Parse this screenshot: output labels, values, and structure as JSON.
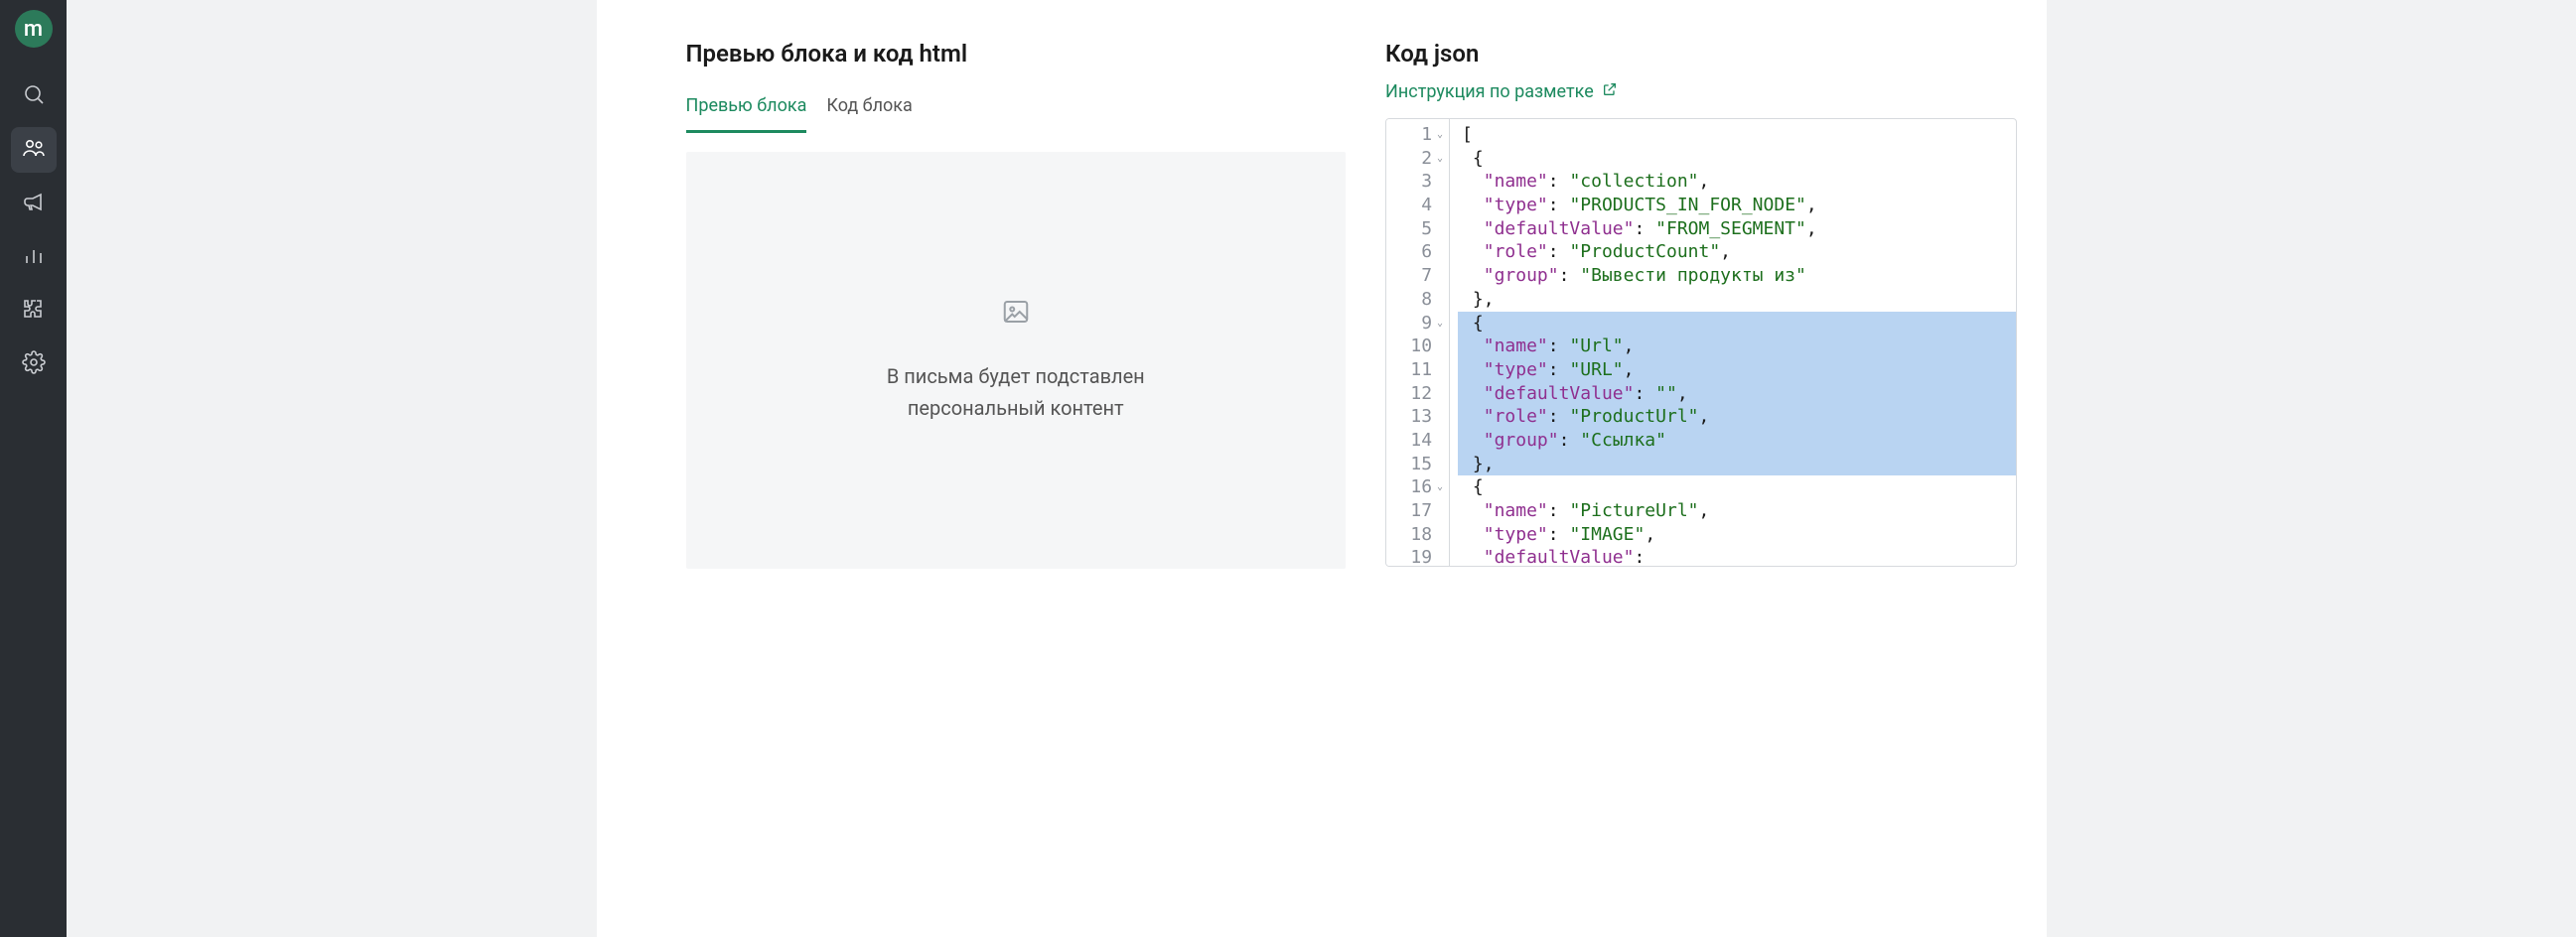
{
  "logo_letter": "m",
  "sidebar": {
    "items": [
      {
        "name": "search-icon"
      },
      {
        "name": "people-icon"
      },
      {
        "name": "megaphone-icon"
      },
      {
        "name": "bar-chart-icon"
      },
      {
        "name": "puzzle-icon"
      },
      {
        "name": "gear-icon"
      }
    ]
  },
  "page": {
    "title": "Превью блока и код html"
  },
  "tabs": [
    {
      "label": "Превью блока",
      "active": true
    },
    {
      "label": "Код блока",
      "active": false
    }
  ],
  "preview": {
    "line1": "В письма будет подставлен",
    "line2": "персональный контент"
  },
  "json_section": {
    "title": "Код json",
    "link_text": "Инструкция по разметке"
  },
  "code": {
    "lines": [
      {
        "n": 1,
        "foldable": true,
        "hl": false,
        "tokens": [
          {
            "t": "punct",
            "v": "["
          }
        ]
      },
      {
        "n": 2,
        "foldable": true,
        "hl": false,
        "tokens": [
          {
            "t": "pad",
            "v": " "
          },
          {
            "t": "punct",
            "v": "{"
          }
        ]
      },
      {
        "n": 3,
        "foldable": false,
        "hl": false,
        "tokens": [
          {
            "t": "pad",
            "v": "  "
          },
          {
            "t": "key",
            "v": "\"name\""
          },
          {
            "t": "colon",
            "v": ": "
          },
          {
            "t": "str",
            "v": "\"collection\""
          },
          {
            "t": "punct",
            "v": ","
          }
        ]
      },
      {
        "n": 4,
        "foldable": false,
        "hl": false,
        "tokens": [
          {
            "t": "pad",
            "v": "  "
          },
          {
            "t": "key",
            "v": "\"type\""
          },
          {
            "t": "colon",
            "v": ": "
          },
          {
            "t": "str",
            "v": "\"PRODUCTS_IN_FOR_NODE\""
          },
          {
            "t": "punct",
            "v": ","
          }
        ]
      },
      {
        "n": 5,
        "foldable": false,
        "hl": false,
        "tokens": [
          {
            "t": "pad",
            "v": "  "
          },
          {
            "t": "key",
            "v": "\"defaultValue\""
          },
          {
            "t": "colon",
            "v": ": "
          },
          {
            "t": "str",
            "v": "\"FROM_SEGMENT\""
          },
          {
            "t": "punct",
            "v": ","
          }
        ]
      },
      {
        "n": 6,
        "foldable": false,
        "hl": false,
        "tokens": [
          {
            "t": "pad",
            "v": "  "
          },
          {
            "t": "key",
            "v": "\"role\""
          },
          {
            "t": "colon",
            "v": ": "
          },
          {
            "t": "str",
            "v": "\"ProductCount\""
          },
          {
            "t": "punct",
            "v": ","
          }
        ]
      },
      {
        "n": 7,
        "foldable": false,
        "hl": false,
        "tokens": [
          {
            "t": "pad",
            "v": "  "
          },
          {
            "t": "key",
            "v": "\"group\""
          },
          {
            "t": "colon",
            "v": ": "
          },
          {
            "t": "str",
            "v": "\"Вывести продукты из\""
          }
        ]
      },
      {
        "n": 8,
        "foldable": false,
        "hl": false,
        "tokens": [
          {
            "t": "pad",
            "v": " "
          },
          {
            "t": "punct",
            "v": "},"
          }
        ]
      },
      {
        "n": 9,
        "foldable": true,
        "hl": true,
        "tokens": [
          {
            "t": "pad",
            "v": " "
          },
          {
            "t": "punct",
            "v": "{"
          }
        ]
      },
      {
        "n": 10,
        "foldable": false,
        "hl": true,
        "tokens": [
          {
            "t": "pad",
            "v": "  "
          },
          {
            "t": "key",
            "v": "\"name\""
          },
          {
            "t": "colon",
            "v": ": "
          },
          {
            "t": "str",
            "v": "\"Url\""
          },
          {
            "t": "punct",
            "v": ","
          }
        ]
      },
      {
        "n": 11,
        "foldable": false,
        "hl": true,
        "tokens": [
          {
            "t": "pad",
            "v": "  "
          },
          {
            "t": "key",
            "v": "\"type\""
          },
          {
            "t": "colon",
            "v": ": "
          },
          {
            "t": "str",
            "v": "\"URL\""
          },
          {
            "t": "punct",
            "v": ","
          }
        ]
      },
      {
        "n": 12,
        "foldable": false,
        "hl": true,
        "tokens": [
          {
            "t": "pad",
            "v": "  "
          },
          {
            "t": "key",
            "v": "\"defaultValue\""
          },
          {
            "t": "colon",
            "v": ": "
          },
          {
            "t": "str",
            "v": "\"\""
          },
          {
            "t": "punct",
            "v": ","
          }
        ]
      },
      {
        "n": 13,
        "foldable": false,
        "hl": true,
        "tokens": [
          {
            "t": "pad",
            "v": "  "
          },
          {
            "t": "key",
            "v": "\"role\""
          },
          {
            "t": "colon",
            "v": ": "
          },
          {
            "t": "str",
            "v": "\"ProductUrl\""
          },
          {
            "t": "punct",
            "v": ","
          }
        ]
      },
      {
        "n": 14,
        "foldable": false,
        "hl": true,
        "tokens": [
          {
            "t": "pad",
            "v": "  "
          },
          {
            "t": "key",
            "v": "\"group\""
          },
          {
            "t": "colon",
            "v": ": "
          },
          {
            "t": "str",
            "v": "\"Ссылка\""
          }
        ]
      },
      {
        "n": 15,
        "foldable": false,
        "hl": true,
        "tokens": [
          {
            "t": "pad",
            "v": " "
          },
          {
            "t": "punct",
            "v": "},"
          }
        ]
      },
      {
        "n": 16,
        "foldable": true,
        "hl": false,
        "tokens": [
          {
            "t": "pad",
            "v": " "
          },
          {
            "t": "punct",
            "v": "{"
          }
        ]
      },
      {
        "n": 17,
        "foldable": false,
        "hl": false,
        "tokens": [
          {
            "t": "pad",
            "v": "  "
          },
          {
            "t": "key",
            "v": "\"name\""
          },
          {
            "t": "colon",
            "v": ": "
          },
          {
            "t": "str",
            "v": "\"PictureUrl\""
          },
          {
            "t": "punct",
            "v": ","
          }
        ]
      },
      {
        "n": 18,
        "foldable": false,
        "hl": false,
        "tokens": [
          {
            "t": "pad",
            "v": "  "
          },
          {
            "t": "key",
            "v": "\"type\""
          },
          {
            "t": "colon",
            "v": ": "
          },
          {
            "t": "str",
            "v": "\"IMAGE\""
          },
          {
            "t": "punct",
            "v": ","
          }
        ]
      },
      {
        "n": 19,
        "foldable": false,
        "hl": false,
        "tokens": [
          {
            "t": "pad",
            "v": "  "
          },
          {
            "t": "key",
            "v": "\"defaultValue\""
          },
          {
            "t": "colon",
            "v": ":"
          }
        ]
      }
    ]
  }
}
